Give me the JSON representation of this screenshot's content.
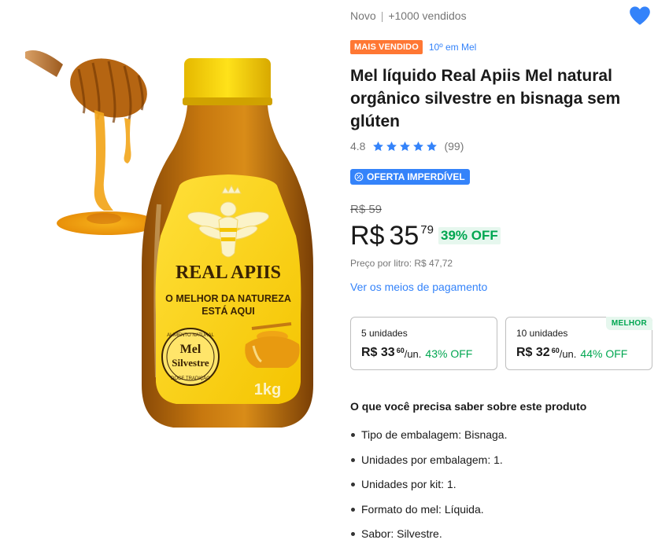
{
  "product_image": {
    "label_brand": "REAL APIIS",
    "label_slogan_1": "O MELHOR DA NATUREZA",
    "label_slogan_2": "ESTÁ AQUI",
    "seal_top": "ALIMENTO NATURAL",
    "seal_line_1": "Mel",
    "seal_line_2": "Silvestre",
    "seal_bottom": "DOCE TRADIÇÃO",
    "weight": "1kg"
  },
  "header": {
    "condition": "Novo",
    "separator": "|",
    "sold": "+1000 vendidos",
    "favorite_icon": "heart-icon",
    "favorite_color": "#3483fa"
  },
  "badges": {
    "best_seller": "MAIS VENDIDO",
    "rank": "10º em Mel"
  },
  "title": "Mel líquido Real Apiis Mel natural orgânico silvestre en bisnaga sem glúten",
  "rating": {
    "score": "4.8",
    "stars": 5,
    "count": "(99)",
    "star_color": "#3483fa"
  },
  "deal_badge": "OFERTA IMPERDÍVEL",
  "pricing": {
    "old_price": "R$ 59",
    "currency": "R$",
    "integer": "35",
    "cents": "79",
    "discount": "39% OFF",
    "per_liter": "Preço por litro: R$ 47,72",
    "payment_link": "Ver os meios de pagamento"
  },
  "bulk_options": [
    {
      "qty": "5 unidades",
      "price": "R$ 33",
      "cents": "60",
      "unit": "/un.",
      "discount": "43% OFF",
      "tag": ""
    },
    {
      "qty": "10 unidades",
      "price": "R$ 32",
      "cents": "60",
      "unit": "/un.",
      "discount": "44% OFF",
      "tag": "MELHOR"
    }
  ],
  "specs": {
    "title": "O que você precisa saber sobre este produto",
    "items": [
      "Tipo de embalagem: Bisnaga.",
      "Unidades por embalagem: 1.",
      "Unidades por kit: 1.",
      "Formato do mel: Líquida.",
      "Sabor: Silvestre."
    ]
  },
  "colors": {
    "accent_blue": "#3483fa",
    "badge_orange": "#ff7733",
    "discount_green": "#00a650"
  }
}
